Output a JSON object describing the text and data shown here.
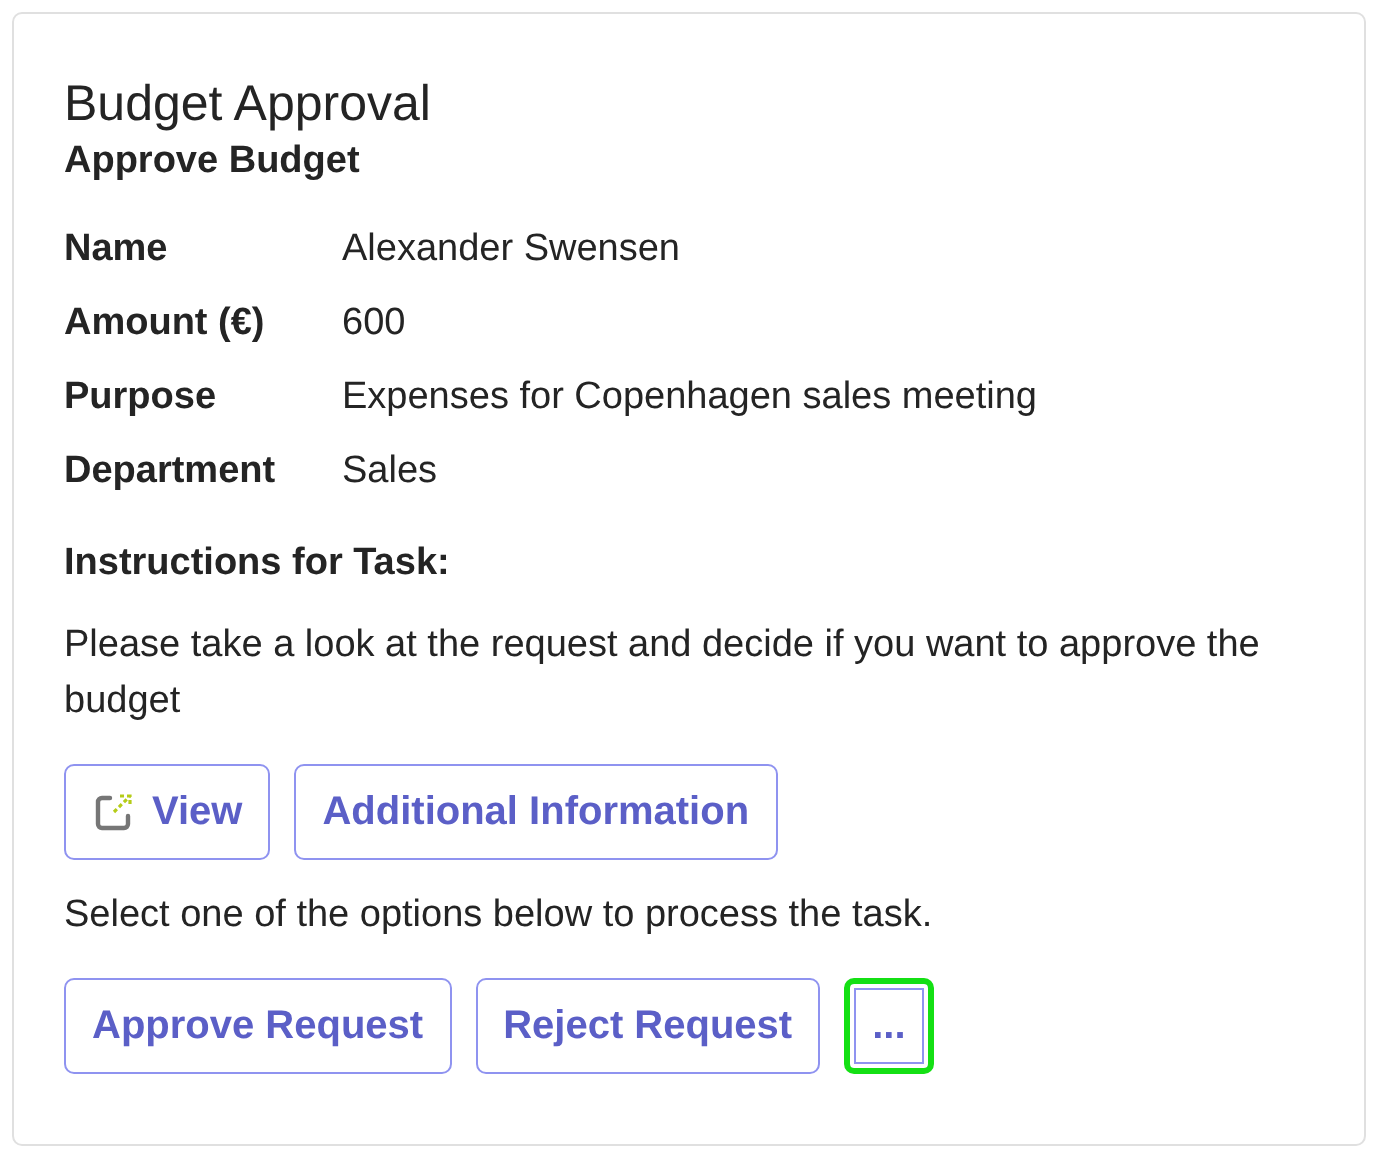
{
  "card": {
    "title": "Budget Approval",
    "subtitle": "Approve Budget",
    "fields": [
      {
        "label": "Name",
        "value": "Alexander Swensen"
      },
      {
        "label": "Amount (€)",
        "value": "600"
      },
      {
        "label": "Purpose",
        "value": "Expenses for Copenhagen sales meeting"
      },
      {
        "label": "Department",
        "value": "Sales"
      }
    ],
    "instructions_heading": "Instructions for Task:",
    "instructions": "Please take a look at the request and decide if you want to approve the budget",
    "link_buttons": [
      {
        "kind": "open",
        "label": "View"
      },
      {
        "kind": "plain",
        "label": "Additional Information"
      }
    ],
    "prompt": "Select one of the options below to process the task.",
    "actions": [
      {
        "label": "Approve Request",
        "focused": false
      },
      {
        "label": "Reject Request",
        "focused": false
      },
      {
        "label": "...",
        "focused": true
      }
    ]
  }
}
